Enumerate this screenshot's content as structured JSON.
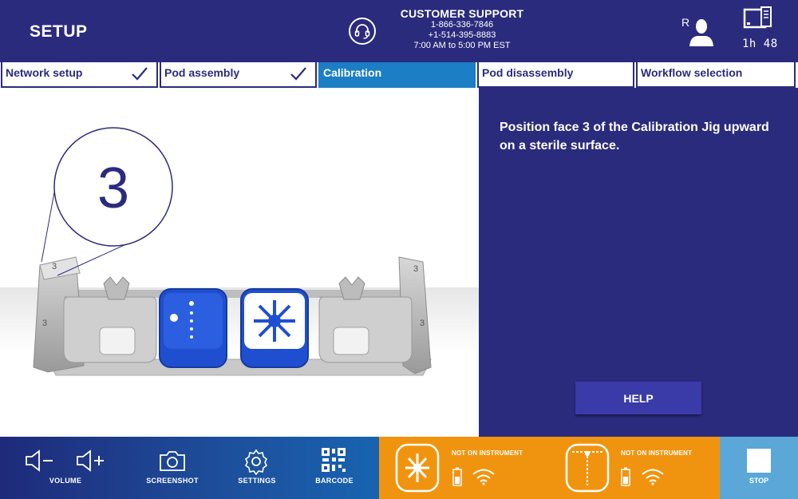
{
  "header": {
    "title": "SETUP",
    "support_title": "CUSTOMER SUPPORT",
    "phone_1": "1-866-336-7846",
    "phone_2": "+1-514-395-8883",
    "hours": "7:00 AM to 5:00 PM EST",
    "user_letter": "R",
    "timer": "1h 48"
  },
  "steps": [
    {
      "label": "Network setup",
      "done": true
    },
    {
      "label": "Pod assembly",
      "done": true
    },
    {
      "label": "Calibration",
      "done": false,
      "active": true
    },
    {
      "label": "Pod disassembly",
      "done": false
    },
    {
      "label": "Workflow selection",
      "done": false
    }
  ],
  "illustration": {
    "face_number": "3",
    "jig_face_marks": [
      "3",
      "3",
      "3",
      "3"
    ]
  },
  "panel": {
    "instruction": "Position face 3 of the Calibration Jig upward on a sterile surface.",
    "help_label": "HELP"
  },
  "toolbar": {
    "volume_label": "VOLUME",
    "screenshot_label": "SCREENSHOT",
    "settings_label": "SETTINGS",
    "barcode_label": "BARCODE",
    "stop_label": "STOP"
  },
  "pods": [
    {
      "status": "NOT ON INSTRUMENT",
      "icon": "pod-arrows-icon"
    },
    {
      "status": "NOT ON INSTRUMENT",
      "icon": "pod-flexion-icon"
    }
  ],
  "colors": {
    "header_bg": "#2b2b7e",
    "active_step": "#1c7ec4",
    "orange": "#f0940f",
    "stop_bg": "#5aa7d8",
    "pod_blue": "#1f4fd0"
  }
}
